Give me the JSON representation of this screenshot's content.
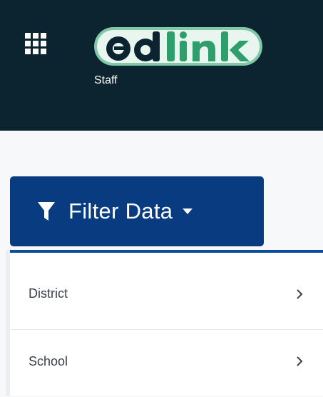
{
  "header": {
    "apps_icon": "apps-grid-icon",
    "logo_text": "edlink",
    "role_label": "Staff",
    "background_color": "#0c2330"
  },
  "filter": {
    "label": "Filter Data",
    "icon": "funnel-icon",
    "caret_icon": "caret-down-icon",
    "background_color": "#083b80"
  },
  "menu": {
    "items": [
      {
        "label": "District",
        "icon": "chevron-right-icon"
      },
      {
        "label": "School",
        "icon": "chevron-right-icon"
      }
    ],
    "accent_color": "#0a4d9c"
  }
}
